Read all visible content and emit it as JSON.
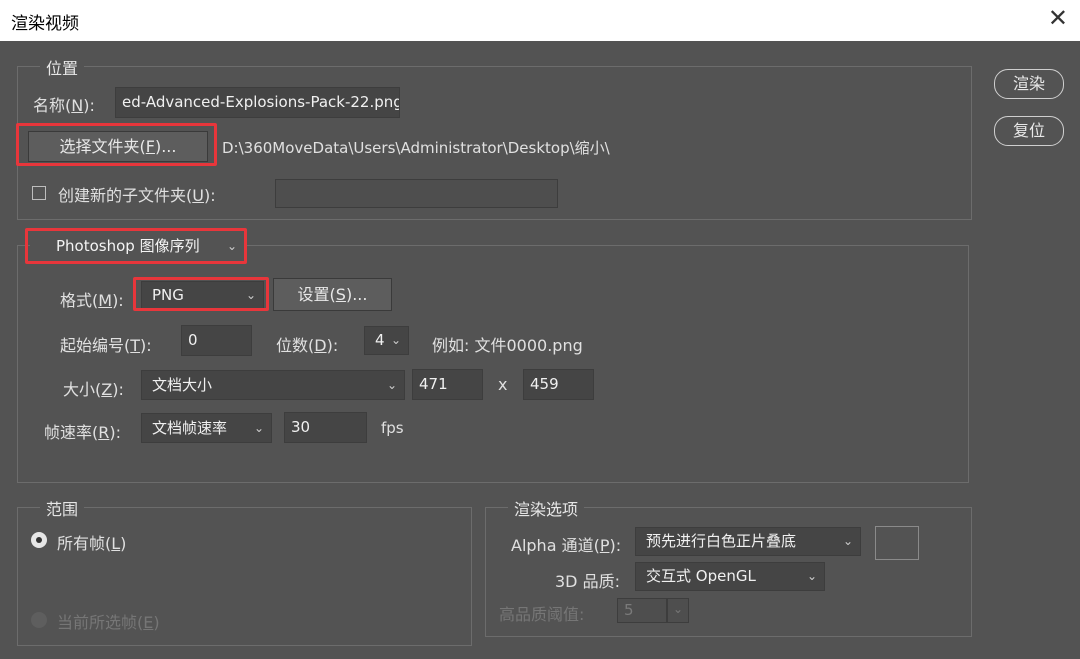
{
  "window": {
    "title": "渲染视频",
    "close_glyph": "✕"
  },
  "actions": {
    "render": "渲染",
    "reset": "复位"
  },
  "location": {
    "legend": "位置",
    "name_label_pre": "名称(",
    "name_label_key": "N",
    "name_label_post": "):",
    "name_value": "ed-Advanced-Explosions-Pack-22.png",
    "choose_folder_pre": "选择文件夹(",
    "choose_folder_key": "F",
    "choose_folder_post": ")...",
    "folder_path": "D:\\360MoveData\\Users\\Administrator\\Desktop\\缩小\\",
    "subfolder_pre": "创建新的子文件夹(",
    "subfolder_key": "U",
    "subfolder_post": "):",
    "subfolder_checked": false,
    "subfolder_value": ""
  },
  "sequence": {
    "type": "Photoshop 图像序列",
    "format_pre": "格式(",
    "format_key": "M",
    "format_post": "):",
    "format_value": "PNG",
    "settings_pre": "设置(",
    "settings_key": "S",
    "settings_post": ")...",
    "start_pre": "起始编号(",
    "start_key": "T",
    "start_post": "):",
    "start_value": "0",
    "digits_pre": "位数(",
    "digits_key": "D",
    "digits_post": "):",
    "digits_value": "4",
    "example": "例如: 文件0000.png",
    "size_pre": "大小(",
    "size_key": "Z",
    "size_post": "):",
    "size_value": "文档大小",
    "width": "471",
    "x_sep": "x",
    "height": "459",
    "fps_pre": "帧速率(",
    "fps_key": "R",
    "fps_post": "):",
    "fps_mode": "文档帧速率",
    "fps_value": "30",
    "fps_unit": "fps"
  },
  "range": {
    "legend": "范围",
    "all_pre": "所有帧(",
    "all_key": "L",
    "all_post": ")",
    "current_pre": "当前所选帧(",
    "current_key": "E",
    "current_post": ")"
  },
  "render_options": {
    "legend": "渲染选项",
    "alpha_pre": "Alpha 通道(",
    "alpha_key": "P",
    "alpha_post": "):",
    "alpha_value": "预先进行白色正片叠底",
    "quality_label": "3D 品质:",
    "quality_value": "交互式 OpenGL",
    "threshold_label": "高品质阈值:",
    "threshold_value": "5"
  }
}
